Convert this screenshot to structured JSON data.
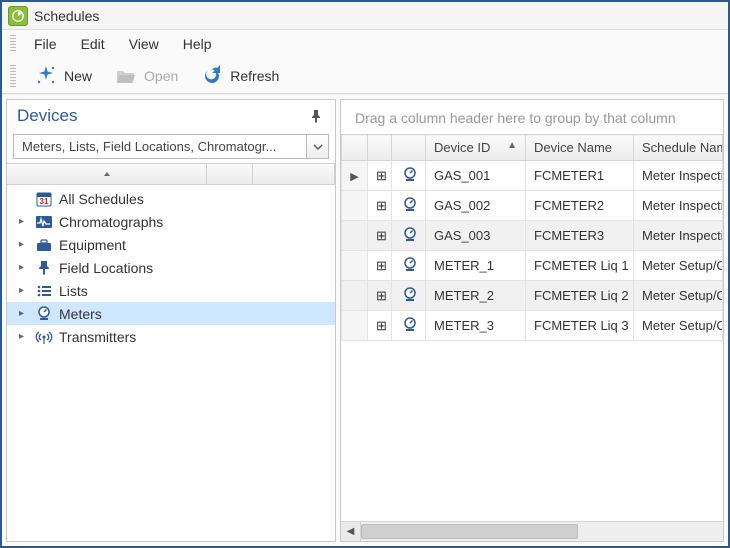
{
  "window": {
    "title": "Schedules"
  },
  "menu": {
    "file": "File",
    "edit": "Edit",
    "view": "View",
    "help": "Help"
  },
  "toolbar": {
    "new": "New",
    "open": "Open",
    "refresh": "Refresh"
  },
  "sidebar": {
    "title": "Devices",
    "filter_text": "Meters, Lists, Field Locations, Chromatogr...",
    "items": [
      {
        "label": "All Schedules",
        "icon": "calendar-icon",
        "expandable": false
      },
      {
        "label": "Chromatographs",
        "icon": "pulse-icon",
        "expandable": true
      },
      {
        "label": "Equipment",
        "icon": "toolbox-icon",
        "expandable": true
      },
      {
        "label": "Field Locations",
        "icon": "pin-icon",
        "expandable": true
      },
      {
        "label": "Lists",
        "icon": "list-icon",
        "expandable": true
      },
      {
        "label": "Meters",
        "icon": "meter-icon",
        "expandable": true,
        "selected": true
      },
      {
        "label": "Transmitters",
        "icon": "antenna-icon",
        "expandable": true
      }
    ]
  },
  "grid": {
    "group_hint": "Drag a column header here to group by that column",
    "columns": [
      {
        "label": "Device ID",
        "sorted": "asc"
      },
      {
        "label": "Device Name"
      },
      {
        "label": "Schedule Name"
      }
    ],
    "rows": [
      {
        "device_id": "GAS_001",
        "device_name": "FCMETER1",
        "schedule_name": "Meter Inspecti",
        "current": true
      },
      {
        "device_id": "GAS_002",
        "device_name": "FCMETER2",
        "schedule_name": "Meter Inspecti"
      },
      {
        "device_id": "GAS_003",
        "device_name": "FCMETER3",
        "schedule_name": "Meter Inspecti",
        "selected": true
      },
      {
        "device_id": "METER_1",
        "device_name": "FCMETER Liq 1",
        "schedule_name": "Meter Setup/C"
      },
      {
        "device_id": "METER_2",
        "device_name": "FCMETER Liq 2",
        "schedule_name": "Meter Setup/C",
        "selected": true
      },
      {
        "device_id": "METER_3",
        "device_name": "FCMETER Liq 3",
        "schedule_name": "Meter Setup/C"
      }
    ]
  }
}
